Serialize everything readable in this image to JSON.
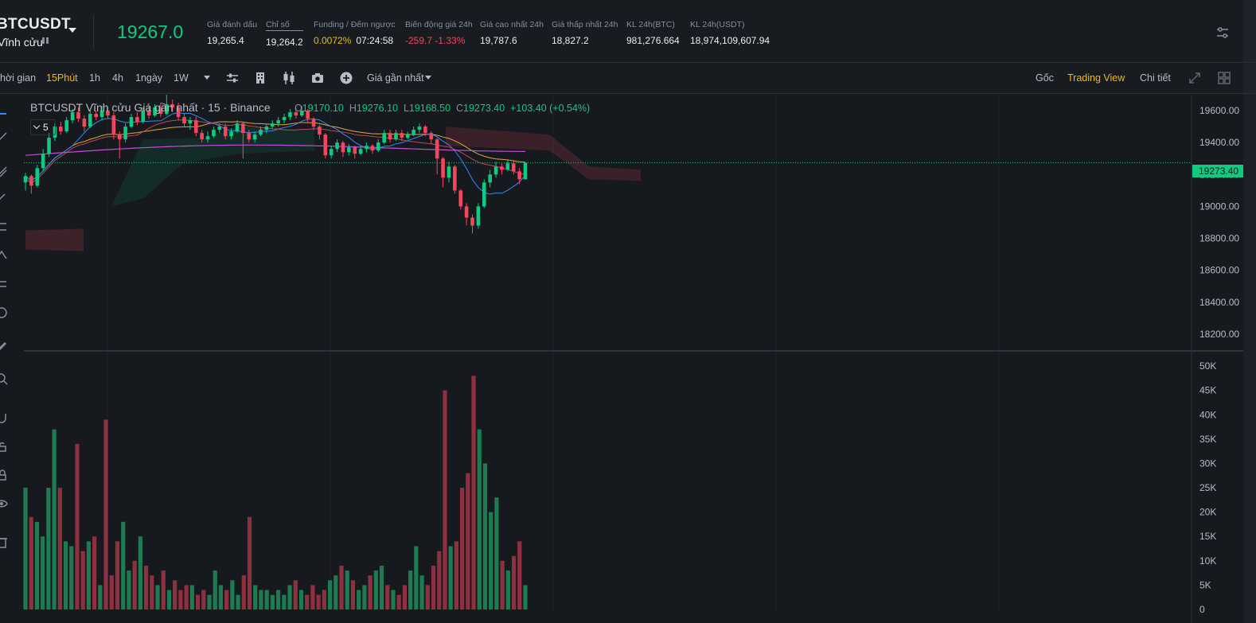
{
  "ticker": {
    "symbol": "BTCUSDT",
    "contract_type": "Vĩnh cửu",
    "last_price": "19267.0",
    "stats": [
      {
        "label": "Giá đánh dấu",
        "value": "19,265.4"
      },
      {
        "label": "Chỉ số",
        "value": "19,264.2"
      },
      {
        "label": "Funding / Đếm ngược",
        "funding": "0.0072%",
        "countdown": "07:24:58"
      },
      {
        "label": "Biến động giá 24h",
        "value": "-259.7 -1.33%"
      },
      {
        "label": "Giá cao nhất 24h",
        "value": "19,787.6"
      },
      {
        "label": "Giá thấp nhất 24h",
        "value": "18,827.2"
      },
      {
        "label": "KL 24h(BTC)",
        "value": "981,276.664"
      },
      {
        "label": "KL 24h(USDT)",
        "value": "18,974,109,607.94"
      }
    ],
    "colors": {
      "up": "#0ecb81",
      "down": "#f6465d",
      "accent": "#f0b90b"
    }
  },
  "toolbar": {
    "time_label": "hời gian",
    "intervals": [
      "15Phút",
      "1h",
      "4h",
      "1ngày",
      "1W"
    ],
    "active_interval": "15Phút",
    "price_type": "Giá gần nhất",
    "views": [
      "Gốc",
      "Trading View",
      "Chi tiết"
    ],
    "active_view": "Trading View",
    "icons": [
      "indicator-settings-icon",
      "building-icon",
      "candles-icon",
      "camera-icon",
      "plus-circle-icon",
      "expand-icon",
      "grid-layout-icon"
    ]
  },
  "chart": {
    "legend_title": "BTCUSDT Vĩnh cửu Giá gần nhất · 15 · Binance",
    "ohlc": {
      "o_label": "O",
      "o": "19170.10",
      "h_label": "H",
      "h": "19276.10",
      "l_label": "L",
      "l": "19168.50",
      "c_label": "C",
      "c": "19273.40",
      "change": "+103.40 (+0.54%)"
    },
    "sub_legend_count": "5",
    "current_price_tag": "19273.40",
    "price_axis": [
      "19600.00",
      "19400.00",
      "19200.00",
      "19000.00",
      "18800.00",
      "18600.00",
      "18400.00",
      "18200.00"
    ],
    "volume_axis": [
      "50K",
      "45K",
      "40K",
      "35K",
      "30K",
      "25K",
      "20K",
      "15K",
      "10K",
      "5K",
      "0"
    ]
  },
  "chart_data": {
    "type": "candlestick",
    "title": "BTCUSDT Vĩnh cửu Giá gần nhất · 15 · Binance",
    "ylim": [
      18100,
      19700
    ],
    "volume_ylim": [
      0,
      52000
    ],
    "current_price": 19273.4,
    "candles": [
      [
        19150,
        19190,
        19100,
        19210
      ],
      [
        19190,
        19130,
        19080,
        19200
      ],
      [
        19130,
        19240,
        19120,
        19260
      ],
      [
        19240,
        19330,
        19220,
        19360
      ],
      [
        19330,
        19430,
        19310,
        19460
      ],
      [
        19430,
        19500,
        19410,
        19520
      ],
      [
        19500,
        19470,
        19450,
        19530
      ],
      [
        19470,
        19540,
        19460,
        19560
      ],
      [
        19540,
        19590,
        19520,
        19610
      ],
      [
        19590,
        19550,
        19530,
        19620
      ],
      [
        19550,
        19500,
        19470,
        19570
      ],
      [
        19500,
        19580,
        19490,
        19600
      ],
      [
        19580,
        19560,
        19540,
        19600
      ],
      [
        19560,
        19600,
        19540,
        19630
      ],
      [
        19600,
        19570,
        19550,
        19620
      ],
      [
        19570,
        19450,
        19420,
        19590
      ],
      [
        19450,
        19420,
        19300,
        19470
      ],
      [
        19420,
        19500,
        19400,
        19520
      ],
      [
        19500,
        19560,
        19490,
        19580
      ],
      [
        19560,
        19530,
        19510,
        19590
      ],
      [
        19530,
        19600,
        19520,
        19620
      ],
      [
        19600,
        19570,
        19550,
        19630
      ],
      [
        19570,
        19620,
        19560,
        19640
      ],
      [
        19620,
        19580,
        19560,
        19650
      ],
      [
        19580,
        19640,
        19570,
        19700
      ],
      [
        19640,
        19620,
        19590,
        19670
      ],
      [
        19620,
        19560,
        19540,
        19650
      ],
      [
        19560,
        19520,
        19500,
        19580
      ],
      [
        19520,
        19540,
        19480,
        19560
      ],
      [
        19540,
        19460,
        19440,
        19560
      ],
      [
        19460,
        19420,
        19400,
        19480
      ],
      [
        19420,
        19440,
        19400,
        19470
      ],
      [
        19440,
        19480,
        19430,
        19500
      ],
      [
        19480,
        19500,
        19460,
        19520
      ],
      [
        19500,
        19440,
        19420,
        19520
      ],
      [
        19440,
        19470,
        19420,
        19490
      ],
      [
        19470,
        19520,
        19460,
        19540
      ],
      [
        19520,
        19460,
        19300,
        19530
      ],
      [
        19460,
        19420,
        19400,
        19480
      ],
      [
        19420,
        19450,
        19400,
        19470
      ],
      [
        19450,
        19480,
        19440,
        19500
      ],
      [
        19480,
        19500,
        19460,
        19520
      ],
      [
        19500,
        19520,
        19490,
        19540
      ],
      [
        19520,
        19540,
        19500,
        19560
      ],
      [
        19540,
        19560,
        19520,
        19580
      ],
      [
        19560,
        19590,
        19540,
        19610
      ],
      [
        19590,
        19570,
        19550,
        19620
      ],
      [
        19570,
        19600,
        19560,
        19630
      ],
      [
        19600,
        19550,
        19530,
        19610
      ],
      [
        19550,
        19500,
        19480,
        19560
      ],
      [
        19500,
        19450,
        19420,
        19510
      ],
      [
        19450,
        19320,
        19300,
        19460
      ],
      [
        19320,
        19360,
        19300,
        19380
      ],
      [
        19360,
        19400,
        19340,
        19420
      ],
      [
        19400,
        19340,
        19310,
        19410
      ],
      [
        19340,
        19370,
        19320,
        19390
      ],
      [
        19370,
        19330,
        19300,
        19380
      ],
      [
        19330,
        19360,
        19320,
        19380
      ],
      [
        19360,
        19380,
        19340,
        19400
      ],
      [
        19380,
        19350,
        19330,
        19390
      ],
      [
        19350,
        19400,
        19340,
        19420
      ],
      [
        19400,
        19460,
        19390,
        19480
      ],
      [
        19460,
        19420,
        19400,
        19480
      ],
      [
        19420,
        19460,
        19410,
        19480
      ],
      [
        19460,
        19430,
        19410,
        19480
      ],
      [
        19430,
        19450,
        19420,
        19470
      ],
      [
        19450,
        19480,
        19440,
        19500
      ],
      [
        19480,
        19500,
        19460,
        19520
      ],
      [
        19500,
        19460,
        19440,
        19510
      ],
      [
        19460,
        19420,
        19390,
        19470
      ],
      [
        19420,
        19300,
        19200,
        19430
      ],
      [
        19300,
        19180,
        19120,
        19310
      ],
      [
        19180,
        19250,
        19150,
        19280
      ],
      [
        19250,
        19100,
        19080,
        19260
      ],
      [
        19100,
        19000,
        18980,
        19110
      ],
      [
        19000,
        18930,
        18880,
        19020
      ],
      [
        18930,
        18880,
        18830,
        18950
      ],
      [
        18880,
        19000,
        18860,
        19020
      ],
      [
        19000,
        19150,
        18990,
        19170
      ],
      [
        19150,
        19200,
        19120,
        19230
      ],
      [
        19200,
        19250,
        19180,
        19280
      ],
      [
        19250,
        19230,
        19200,
        19270
      ],
      [
        19230,
        19270,
        19220,
        19290
      ],
      [
        19270,
        19220,
        19200,
        19290
      ],
      [
        19220,
        19170,
        19140,
        19240
      ],
      [
        19170,
        19273,
        19168,
        19276
      ]
    ],
    "volumes": [
      25000,
      19000,
      18000,
      15000,
      25000,
      37000,
      25000,
      14000,
      13000,
      34000,
      12000,
      14000,
      15000,
      5000,
      39000,
      7000,
      14000,
      18000,
      8000,
      10000,
      15000,
      9000,
      7000,
      5000,
      8000,
      4000,
      6000,
      4000,
      5000,
      5000,
      3000,
      4000,
      3000,
      8000,
      5000,
      4000,
      6000,
      3000,
      7000,
      19000,
      5000,
      4000,
      4000,
      3000,
      4000,
      3000,
      5000,
      6000,
      4000,
      3000,
      5000,
      3000,
      4000,
      6000,
      7000,
      9000,
      8000,
      6000,
      4000,
      5000,
      7000,
      8000,
      9000,
      5000,
      4000,
      3000,
      5000,
      8000,
      13000,
      7000,
      5000,
      9000,
      12000,
      45000,
      13000,
      14000,
      25000,
      28000,
      48000,
      37000,
      30000,
      20000,
      23000,
      10000,
      8000,
      11000,
      14000,
      5000
    ]
  }
}
